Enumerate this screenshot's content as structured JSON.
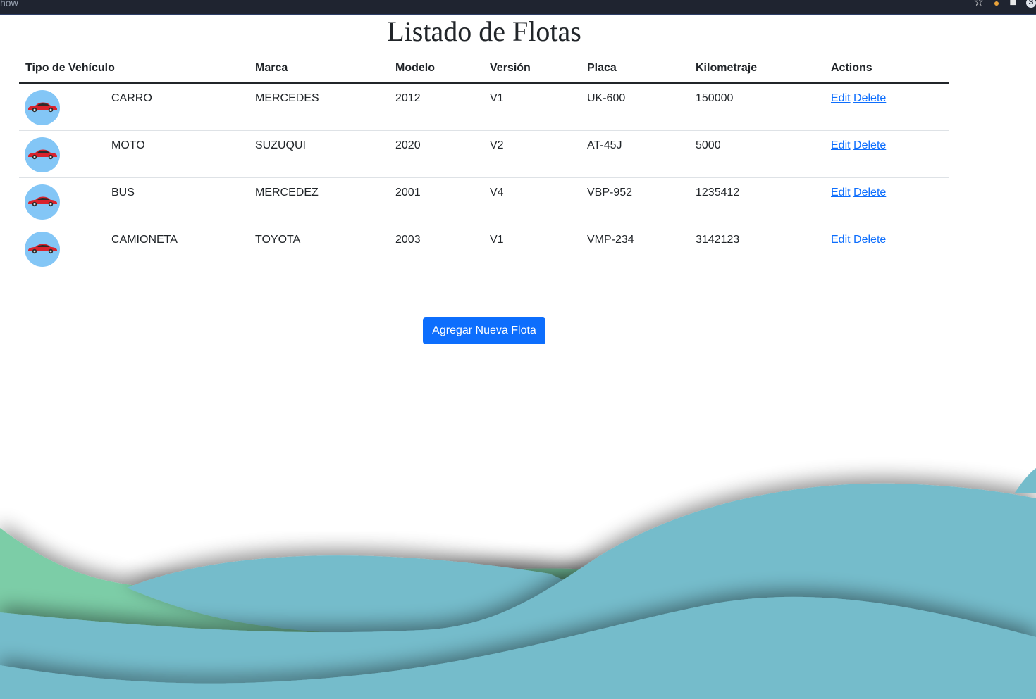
{
  "browser": {
    "partial_text": "how"
  },
  "page": {
    "title": "Listado de Flotas"
  },
  "table": {
    "headers": [
      "Tipo de Vehículo",
      "Marca",
      "Modelo",
      "Versión",
      "Placa",
      "Kilometraje",
      "Actions"
    ],
    "rows": [
      {
        "icon": "car-icon",
        "tipo": "CARRO",
        "marca": "MERCEDES",
        "modelo": "2012",
        "version": "V1",
        "placa": "UK-600",
        "kilometraje": "150000"
      },
      {
        "icon": "car-icon",
        "tipo": "MOTO",
        "marca": "SUZUQUI",
        "modelo": "2020",
        "version": "V2",
        "placa": "AT-45J",
        "kilometraje": "5000"
      },
      {
        "icon": "car-icon",
        "tipo": "BUS",
        "marca": "MERCEDEZ",
        "modelo": "2001",
        "version": "V4",
        "placa": "VBP-952",
        "kilometraje": "1235412"
      },
      {
        "icon": "car-icon",
        "tipo": "CAMIONETA",
        "marca": "TOYOTA",
        "modelo": "2003",
        "version": "V1",
        "placa": "VMP-234",
        "kilometraje": "3142123"
      }
    ],
    "edit_label": "Edit",
    "delete_label": "Delete"
  },
  "actions": {
    "add_label": "Agregar Nueva Flota"
  },
  "colors": {
    "primary": "#0d6efd",
    "avatar_bg": "#83c6f6",
    "wave_blue": "#74bccb",
    "wave_green": "#7ccda7"
  }
}
